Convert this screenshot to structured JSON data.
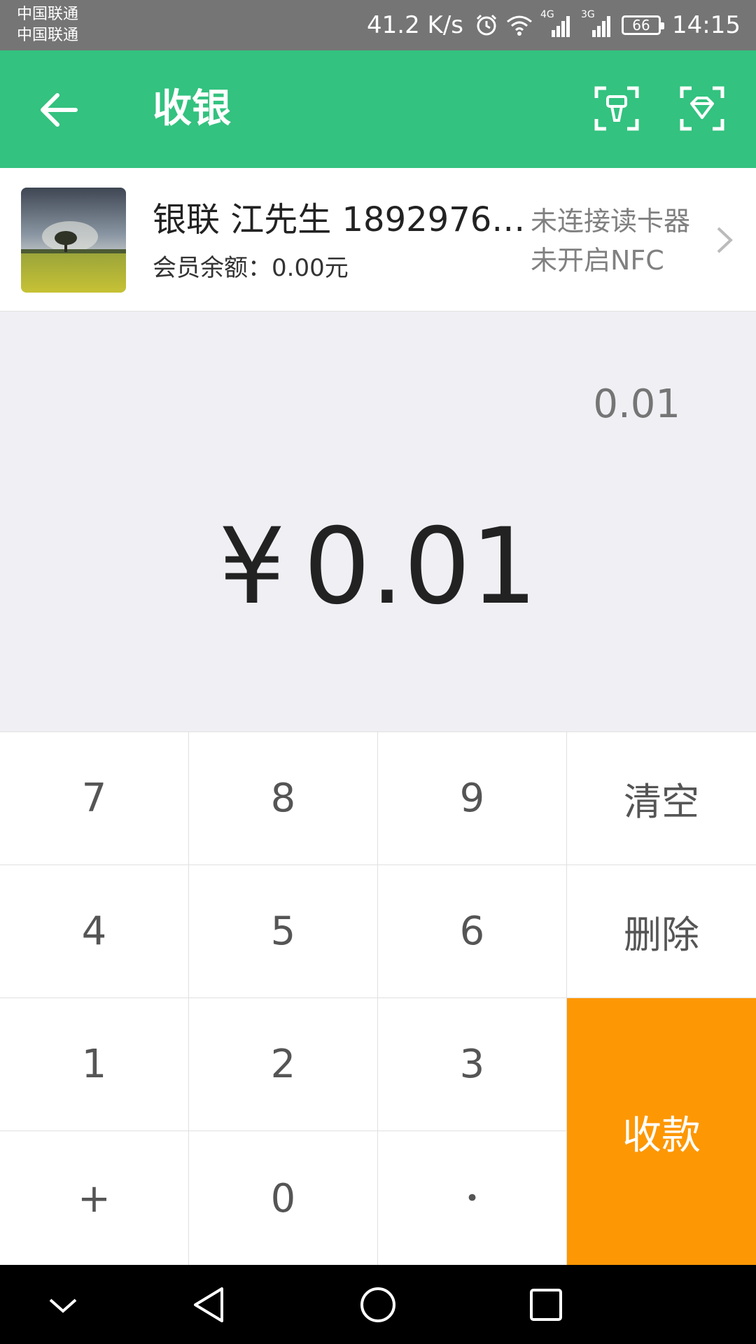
{
  "status_bar": {
    "carrier1": "中国联通",
    "carrier2": "中国联通",
    "speed": "41.2 K/s",
    "battery": "66",
    "time": "14:15",
    "net1": "4G",
    "net2": "3G"
  },
  "header": {
    "title": "收银",
    "icons": [
      "back-arrow-icon",
      "card-scan-icon",
      "diamond-scan-icon"
    ]
  },
  "member": {
    "name": "银联 江先生 18929766...",
    "balance": "会员余额：0.00元",
    "reader_status": "未连接读卡器",
    "nfc_status": "未开启NFC"
  },
  "display": {
    "expression": "0.01",
    "currency": "¥",
    "amount": "0.01"
  },
  "keypad": {
    "k7": "7",
    "k8": "8",
    "k9": "9",
    "clear": "清空",
    "k4": "4",
    "k5": "5",
    "k6": "6",
    "delete": "删除",
    "k1": "1",
    "k2": "2",
    "k3": "3",
    "pay": "收款",
    "plus": "+",
    "k0": "0",
    "dot": "•"
  },
  "colors": {
    "header_bg": "#33c27f",
    "pay_bg": "#fd9704",
    "status_bg": "#757575",
    "display_bg": "#efeff4"
  }
}
